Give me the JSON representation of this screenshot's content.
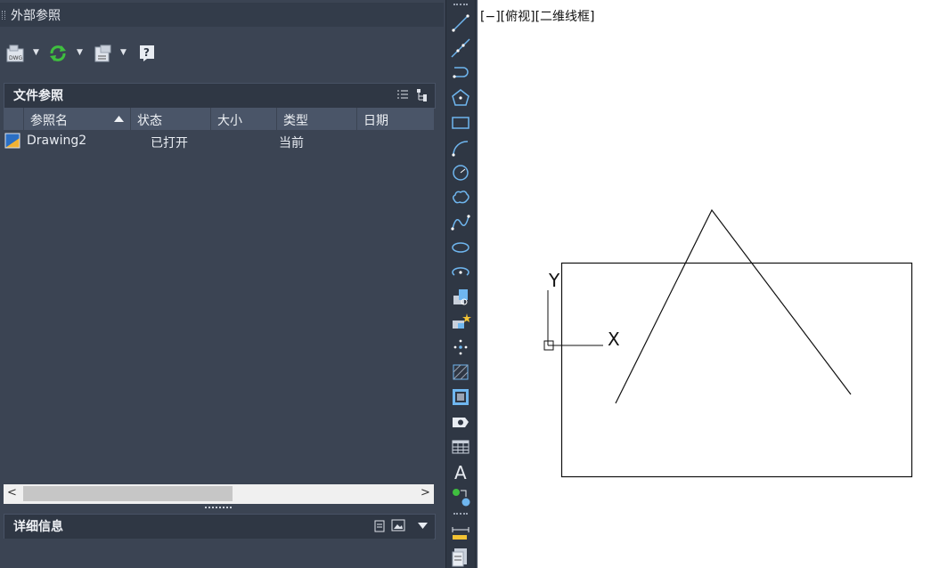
{
  "palette": {
    "title": "外部参照",
    "file_refs_title": "文件参照",
    "columns": [
      "参照名",
      "状态",
      "大小",
      "类型",
      "日期"
    ],
    "rows": [
      {
        "name": "Drawing2",
        "status": "已打开",
        "size": "",
        "type": "当前",
        "date": ""
      }
    ],
    "details_title": "详细信息",
    "toolbar": {
      "attach_dwg_icon": "attach-dwg-icon",
      "refresh_icon": "refresh-icon",
      "change_path_icon": "change-path-icon",
      "help_icon": "help-icon"
    }
  },
  "viewport": {
    "label": "[−][俯视][二维线框]",
    "ucs_x": "X",
    "ucs_y": "Y"
  },
  "draw_toolbar": [
    "line-icon",
    "construction-line-icon",
    "polyline-icon",
    "polygon-icon",
    "rectangle-icon",
    "arc-icon",
    "circle-icon",
    "revision-cloud-icon",
    "spline-icon",
    "ellipse-icon",
    "ellipse-arc-icon",
    "insert-block-icon",
    "create-block-icon",
    "point-icon",
    "hatch-icon",
    "gradient-icon",
    "region-icon",
    "table-icon",
    "multiline-text-icon",
    "add-selected-icon"
  ],
  "colors": {
    "panel": "#3b4453",
    "panel_dark": "#2f3744",
    "header": "#4a5568",
    "canvas": "#ffffff",
    "accent_green": "#3fbf3f",
    "icon_blue": "#5aa8e6"
  }
}
